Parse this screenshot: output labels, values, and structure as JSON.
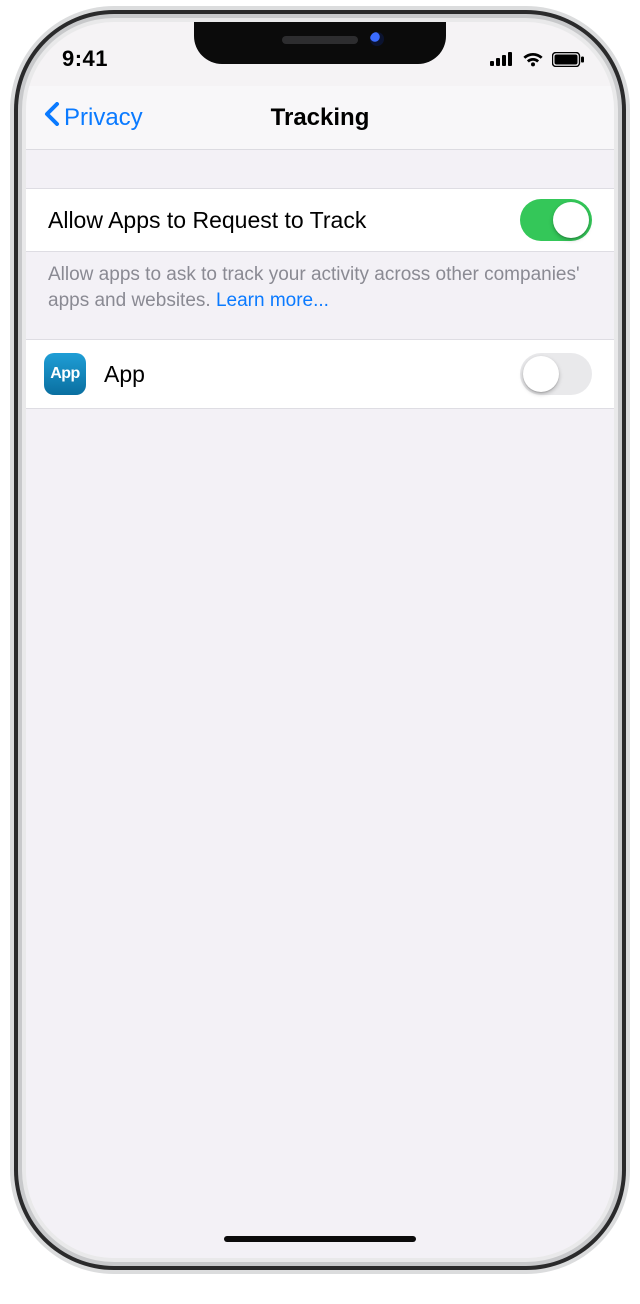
{
  "status": {
    "time": "9:41"
  },
  "nav": {
    "back_label": "Privacy",
    "title": "Tracking"
  },
  "settings": {
    "allow_request_label": "Allow Apps to Request to Track",
    "allow_request_on": true,
    "footer_text": "Allow apps to ask to track your activity across other companies' apps and websites. ",
    "learn_more_label": "Learn more...",
    "apps": [
      {
        "icon_label": "App",
        "name": "App",
        "tracking_on": false
      }
    ]
  }
}
